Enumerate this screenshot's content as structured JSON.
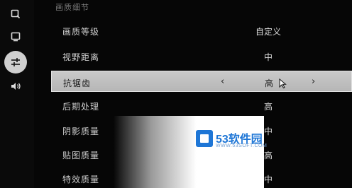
{
  "sidebar": {
    "items": [
      {
        "icon": "search-icon"
      },
      {
        "icon": "display-icon"
      },
      {
        "icon": "sliders-icon",
        "active": true
      },
      {
        "icon": "sound-icon"
      }
    ]
  },
  "section_header": "画质细节",
  "settings": [
    {
      "label": "画质等级",
      "value": "自定义"
    },
    {
      "label": "视野距离",
      "value": "中"
    },
    {
      "label": "抗锯齿",
      "value": "高",
      "selected": true,
      "prev": "‹",
      "next": "›"
    },
    {
      "label": "后期处理",
      "value": "高"
    },
    {
      "label": "阴影质量",
      "value": "中"
    },
    {
      "label": "贴图质量",
      "value": "高"
    },
    {
      "label": "特效质量",
      "value": "中"
    }
  ],
  "watermark": {
    "title": "53软件园",
    "url": "WWW.53SOFT.COM"
  },
  "colors": {
    "accent_blue": "#1e76d6",
    "selected_row": "#c4c4c4",
    "background": "#060606"
  }
}
